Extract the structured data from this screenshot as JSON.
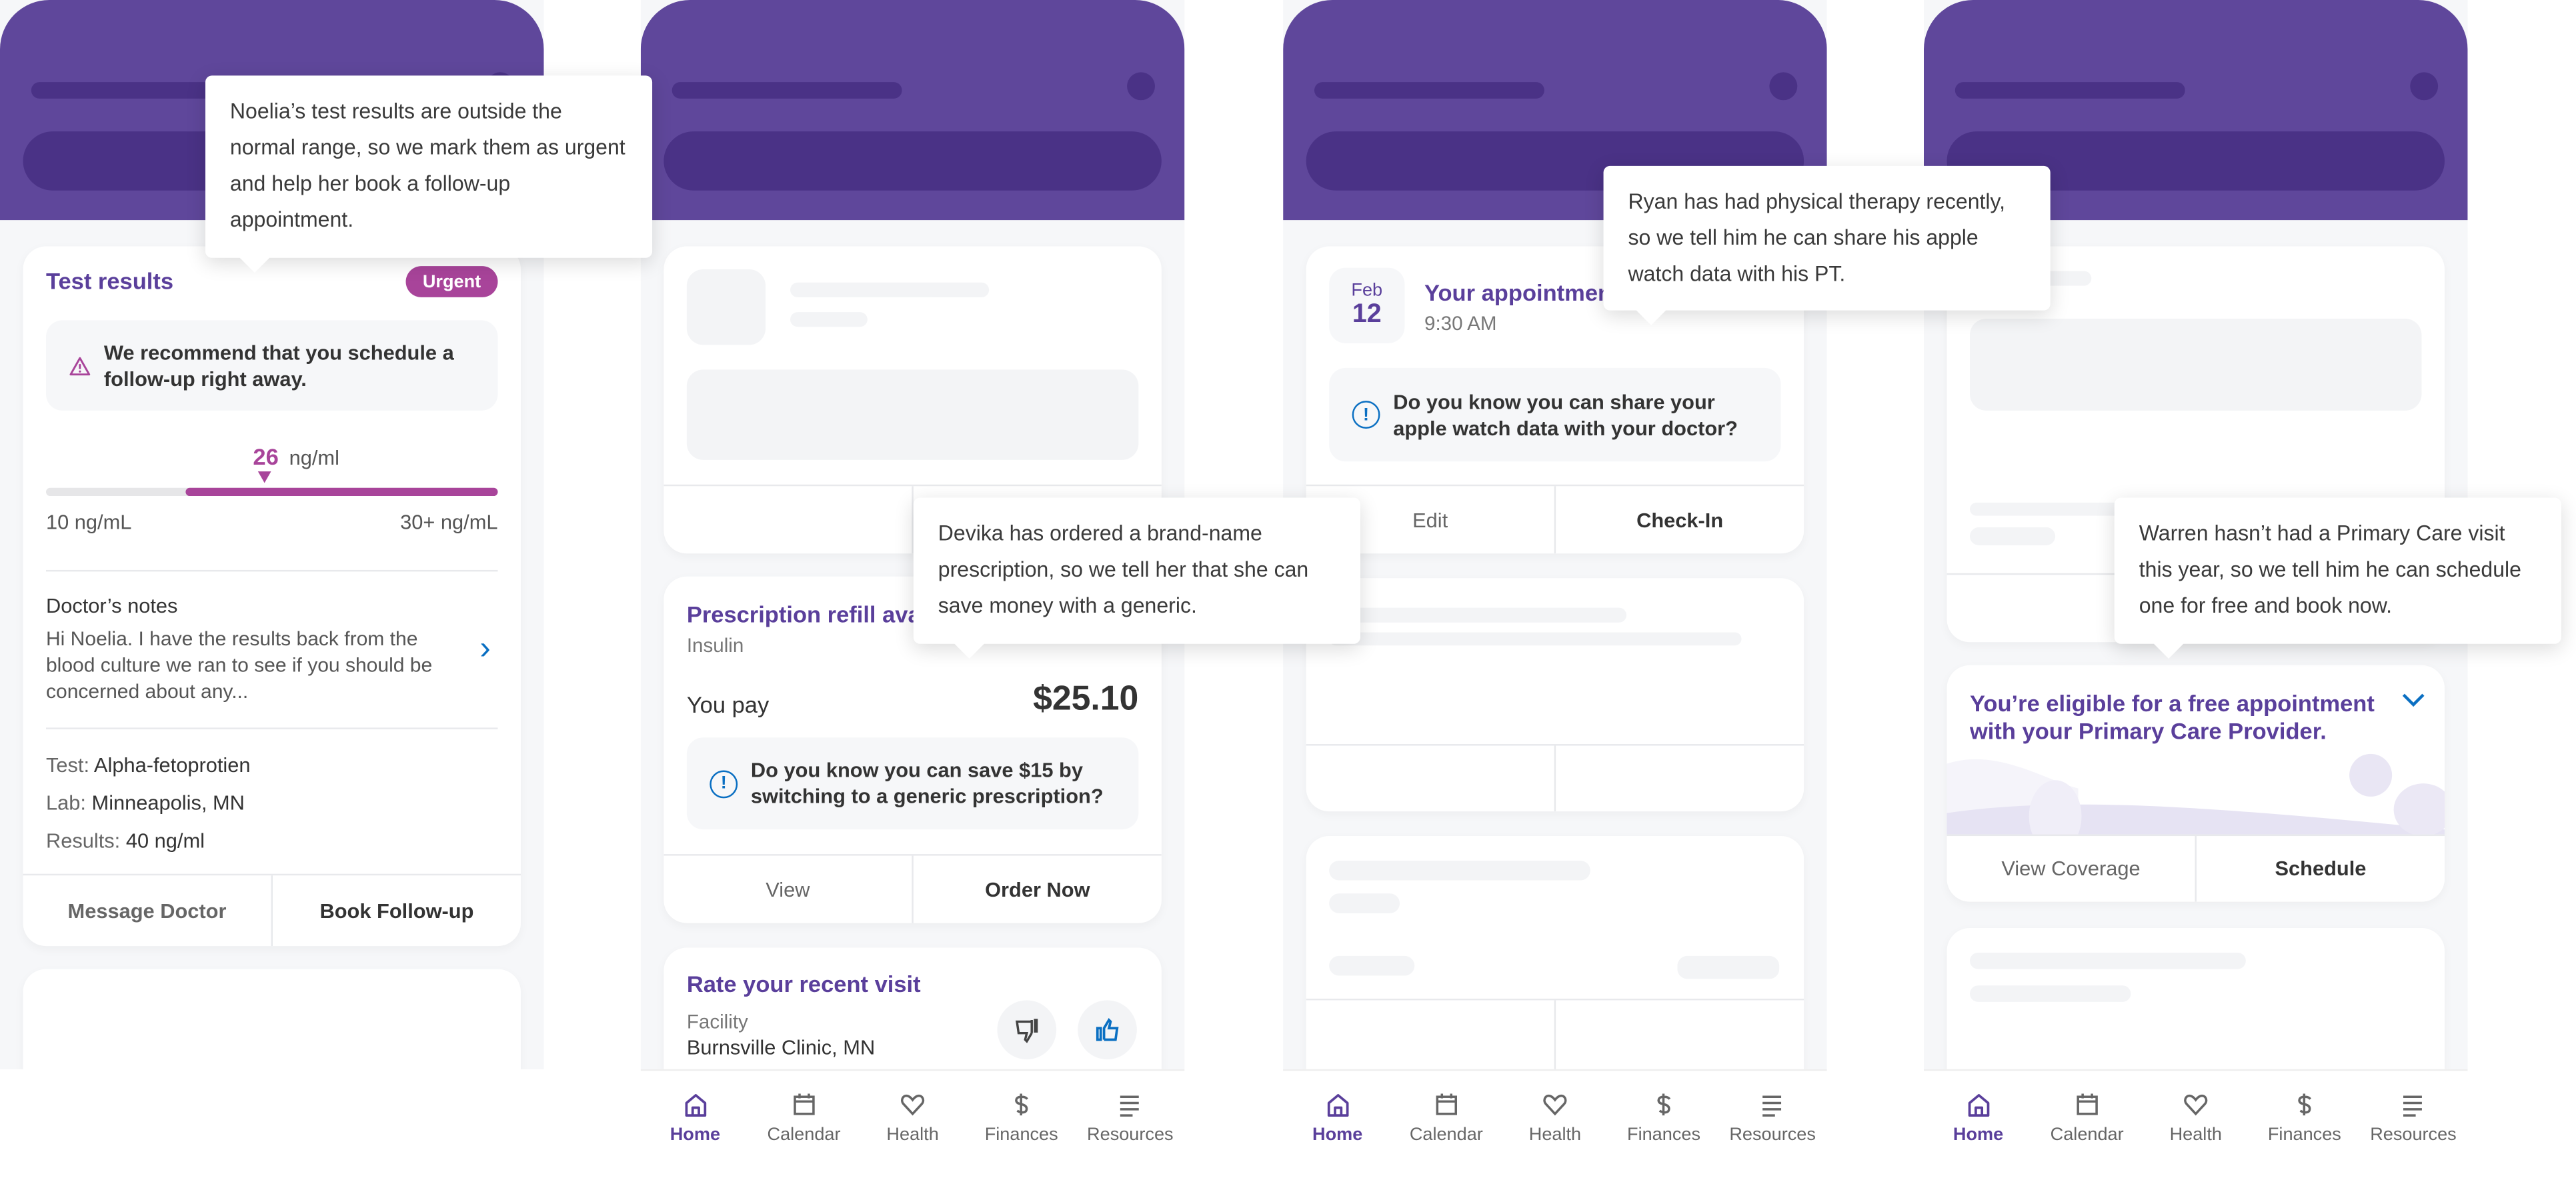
{
  "colors": {
    "brand": "#5f479b",
    "urgent": "#a8449a",
    "info": "#0a6fc2"
  },
  "nav": [
    {
      "label": "Home",
      "icon": "home-icon"
    },
    {
      "label": "Calendar",
      "icon": "calendar-icon"
    },
    {
      "label": "Health",
      "icon": "heart-icon"
    },
    {
      "label": "Finances",
      "icon": "dollar-icon"
    },
    {
      "label": "Resources",
      "icon": "menu-lines-icon"
    }
  ],
  "panel1": {
    "tooltip": "Noelia’s test results are outside the normal range, so we mark them as urgent and help her book a follow-up appointment.",
    "title": "Test results",
    "badge": "Urgent",
    "alert": "We recommend that you schedule a follow-up right away.",
    "value": "26",
    "unit": "ng/ml",
    "range_fill_percent": 69,
    "range_min": "10 ng/mL",
    "range_max": "30+ ng/mL",
    "notes_heading": "Doctor’s notes",
    "notes_text": "Hi Noelia. I have the results back from the blood culture we ran to see if you should be concerned about any...",
    "test_label": "Test:",
    "test_value": "Alpha-fetoprotien",
    "lab_label": "Lab:",
    "lab_value": "Minneapolis, MN",
    "results_label": "Results:",
    "results_value": "40 ng/ml",
    "btn_secondary": "Message Doctor",
    "btn_primary": "Book Follow-up"
  },
  "panel2": {
    "tooltip": "Devika has ordered a brand-name prescription, so we tell her that she can save money with a generic.",
    "title": "Prescription refill available",
    "subtitle": "Insulin",
    "pay_label": "You pay",
    "pay_amount": "$25.10",
    "info": "Do you know you can save $15 by switching to a generic prescription?",
    "btn_secondary": "View",
    "btn_primary": "Order Now",
    "rate_title": "Rate your recent visit",
    "rate_label": "Facility",
    "rate_value": "Burnsville Clinic, MN"
  },
  "panel3": {
    "tooltip": "Ryan has had physical therapy recently, so we tell him he can share his apple watch data with his PT.",
    "month": "Feb",
    "day": "12",
    "title": "Your appointment",
    "time": "9:30 AM",
    "info": "Do you know you can share your apple watch data with your doctor?",
    "btn_secondary": "Edit",
    "btn_primary": "Check-In"
  },
  "panel4": {
    "tooltip": "Warren hasn’t had a Primary Care visit this year, so we tell him he can schedule one for free and book now.",
    "title": "You’re eligible for a free appointment with your Primary Care Provider.",
    "btn_secondary": "View Coverage",
    "btn_primary": "Schedule"
  }
}
